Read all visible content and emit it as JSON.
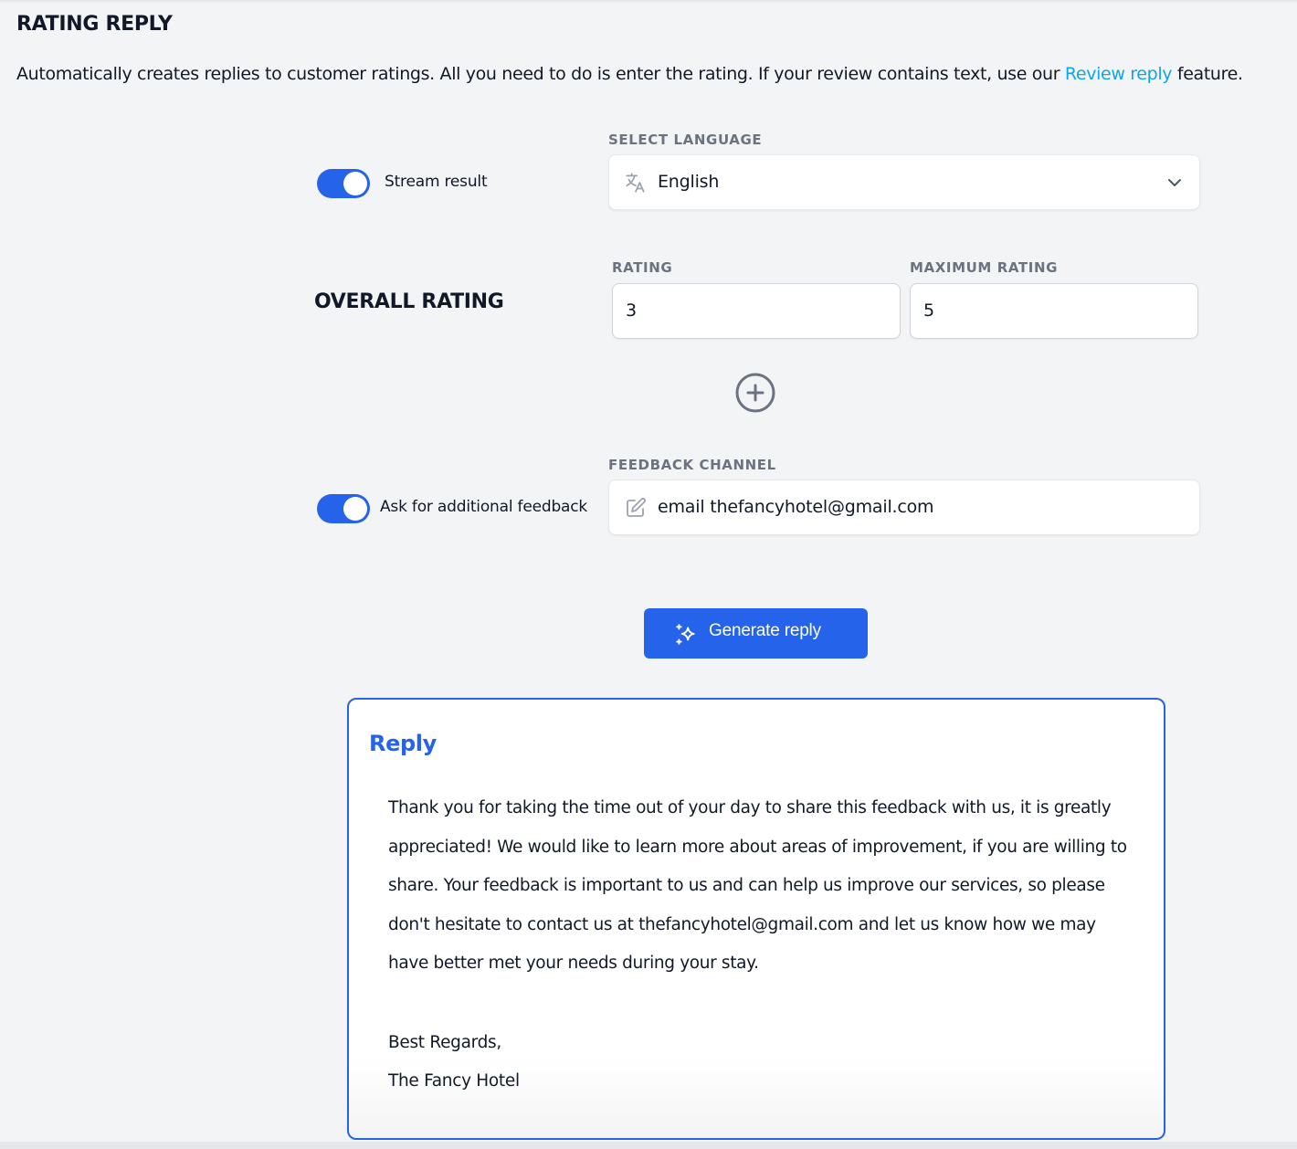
{
  "page": {
    "title": "RATING REPLY",
    "intro_before_link": "Automatically creates replies to customer ratings. All you need to do is enter the rating. If your review contains text, use our ",
    "intro_link": "Review reply",
    "intro_after_link": " feature."
  },
  "stream_toggle": {
    "label": "Stream result",
    "checked": true
  },
  "language": {
    "label": "SELECT LANGUAGE",
    "selected": "English",
    "icon": "translate-icon",
    "dropdown_icon": "chevron-down-icon"
  },
  "overall_rating": {
    "section_label": "OVERALL RATING",
    "rating_label": "RATING",
    "rating_value": "3",
    "max_rating_label": "MAXIMUM RATING",
    "max_rating_value": "5",
    "add_icon": "plus-circle-icon"
  },
  "feedback_toggle": {
    "label": "Ask for additional feedback",
    "checked": true
  },
  "feedback_channel": {
    "label": "FEEDBACK CHANNEL",
    "value": "email thefancyhotel@gmail.com",
    "icon": "edit-icon"
  },
  "generate_button": {
    "label": "Generate reply",
    "icon": "sparkles-icon"
  },
  "reply": {
    "title": "Reply",
    "body": "Thank you for taking the time out of your day to share this feedback with us, it is greatly appreciated! We would like to learn more about areas of improvement, if you are willing to share. Your feedback is important to us and can help us improve our services, so please don't hesitate to contact us at thefancyhotel@gmail.com and let us know how we may have better met your needs during your stay.",
    "closing": "Best Regards,",
    "signature": "The Fancy Hotel"
  },
  "colors": {
    "accent": "#2563eb",
    "link": "#0ea5e9",
    "background": "#f3f4f6",
    "label_gray": "#6b7280"
  }
}
